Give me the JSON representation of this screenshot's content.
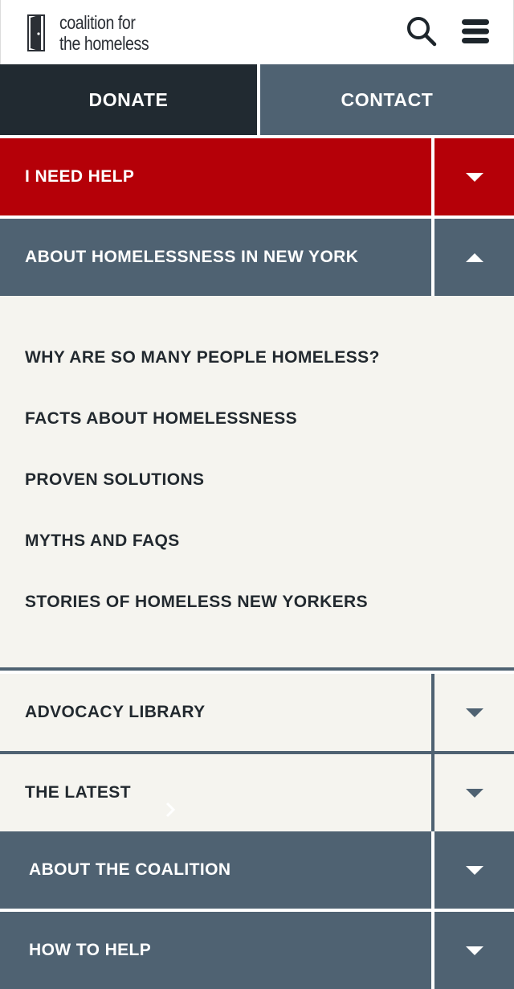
{
  "header": {
    "logo_line1": "coalition for",
    "logo_line2": "the homeless",
    "logo_icon": "door-icon",
    "search_icon": "search-icon",
    "menu_icon": "hamburger-menu-icon"
  },
  "cta": {
    "donate_label": "DONATE",
    "contact_label": "CONTACT"
  },
  "nav": {
    "items": [
      {
        "label": "I NEED HELP",
        "state": "collapsed"
      },
      {
        "label": "ABOUT HOMELESSNESS IN NEW YORK",
        "state": "expanded"
      },
      {
        "label": "ADVOCACY LIBRARY",
        "state": "collapsed"
      },
      {
        "label": "THE LATEST",
        "state": "collapsed"
      },
      {
        "label": "ABOUT THE COALITION",
        "state": "collapsed"
      },
      {
        "label": "HOW TO HELP",
        "state": "collapsed"
      }
    ],
    "submenu": [
      "WHY ARE SO MANY PEOPLE HOMELESS?",
      "FACTS ABOUT HOMELESSNESS",
      "PROVEN SOLUTIONS",
      "MYTHS AND FAQS",
      "STORIES OF HOMELESS NEW YORKERS"
    ]
  },
  "colors": {
    "dark": "#212a31",
    "slate": "#4f6272",
    "red": "#b50008",
    "cream": "#f5f4ef",
    "text_dark": "#22292f"
  }
}
